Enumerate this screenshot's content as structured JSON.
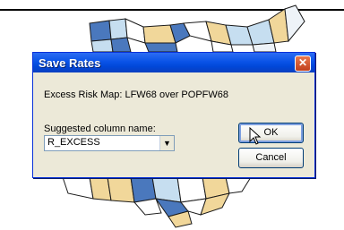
{
  "dialog": {
    "title": "Save Rates",
    "close_glyph": "✕",
    "message": "Excess Risk Map: LFW68 over POPFW68",
    "column_label": "Suggested column name:",
    "column_value": "R_EXCESS",
    "dropdown_glyph": "▼",
    "ok_label": "OK",
    "cancel_label": "Cancel"
  },
  "colors": {
    "map_dark_blue": "#4a78bd",
    "map_light_blue": "#c6def0",
    "map_pale": "#eef3f8",
    "map_tan": "#f1d79a",
    "titlebar": "#0a53e7"
  }
}
